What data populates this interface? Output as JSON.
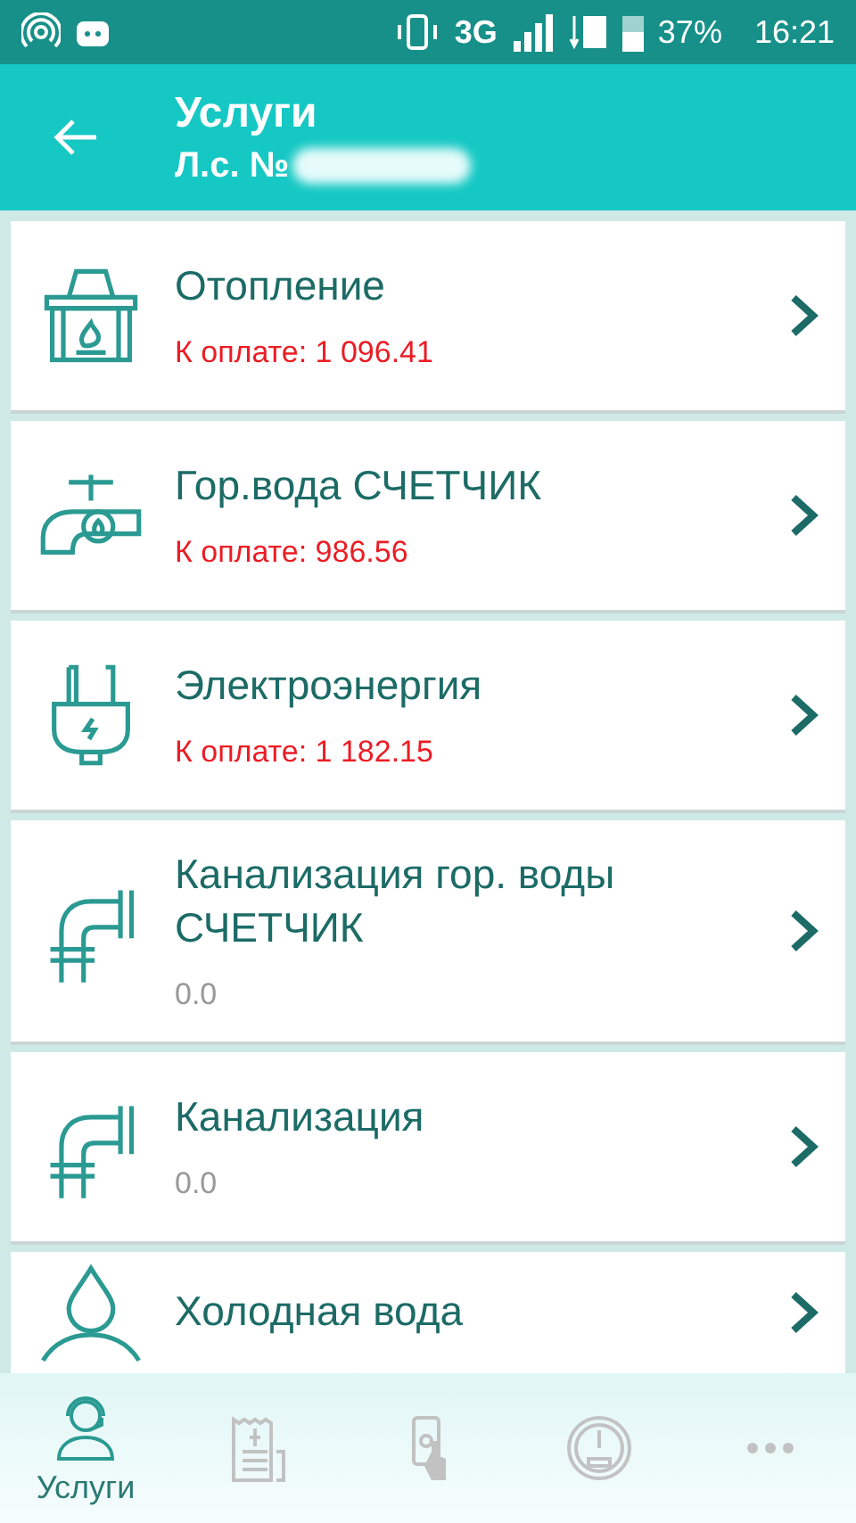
{
  "status_bar": {
    "network": "3G",
    "battery": "37%",
    "time": "16:21"
  },
  "app_bar": {
    "title": "Услуги",
    "subtitle": "Л.с. №"
  },
  "services": [
    {
      "kind": "fireplace",
      "title": "Отопление",
      "amount": "К оплате: 1 096.41",
      "due": true
    },
    {
      "kind": "tap",
      "title": "Гор.вода СЧЕТЧИК",
      "amount": "К оплате: 986.56",
      "due": true
    },
    {
      "kind": "plug",
      "title": "Электроэнергия",
      "amount": "К оплате: 1 182.15",
      "due": true
    },
    {
      "kind": "pipe",
      "title": "Канализация гор. воды СЧЕТЧИК",
      "amount": "0.0",
      "due": false
    },
    {
      "kind": "pipe",
      "title": "Канализация",
      "amount": "0.0",
      "due": false
    },
    {
      "kind": "drop",
      "title": "Холодная вода"
    }
  ],
  "bottom_nav": [
    {
      "kind": "operator",
      "label": "Услуги",
      "selected": true
    },
    {
      "kind": "receipt",
      "selected": false
    },
    {
      "kind": "phone",
      "selected": false
    },
    {
      "kind": "gauge",
      "selected": false
    },
    {
      "kind": "more",
      "selected": false
    }
  ]
}
